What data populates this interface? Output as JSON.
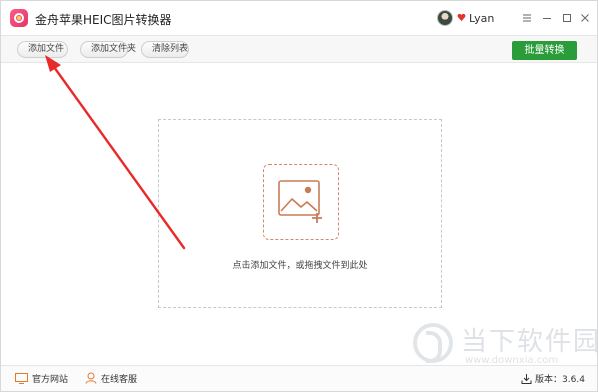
{
  "app": {
    "title": "金舟苹果HEIC图片转换器",
    "icon": "app-logo-icon",
    "accent_color": "#2a9d3a"
  },
  "user": {
    "name": "Lyan",
    "avatar": "avatar-icon",
    "vip_icon": "vip-heart-icon"
  },
  "window_controls": [
    "menu-icon",
    "minimize-icon",
    "maximize-icon",
    "close-icon"
  ],
  "toolbar": {
    "add_file": "添加文件",
    "add_folder": "添加文件夹",
    "clear_list": "清除列表",
    "batch_convert": "批量转换"
  },
  "drop_zone": {
    "icon": "add-image-icon",
    "hint": "点击添加文件，或拖拽文件到此处"
  },
  "statusbar": {
    "official_site": "官方网站",
    "online_service": "在线客服",
    "version_label": "版本：",
    "version": "3.6.4"
  },
  "watermark": {
    "title": "当下软件园",
    "url": "www.downxia.com"
  },
  "annotation": {
    "color": "#e82a2a",
    "icon": "red-arrow-annotation"
  }
}
